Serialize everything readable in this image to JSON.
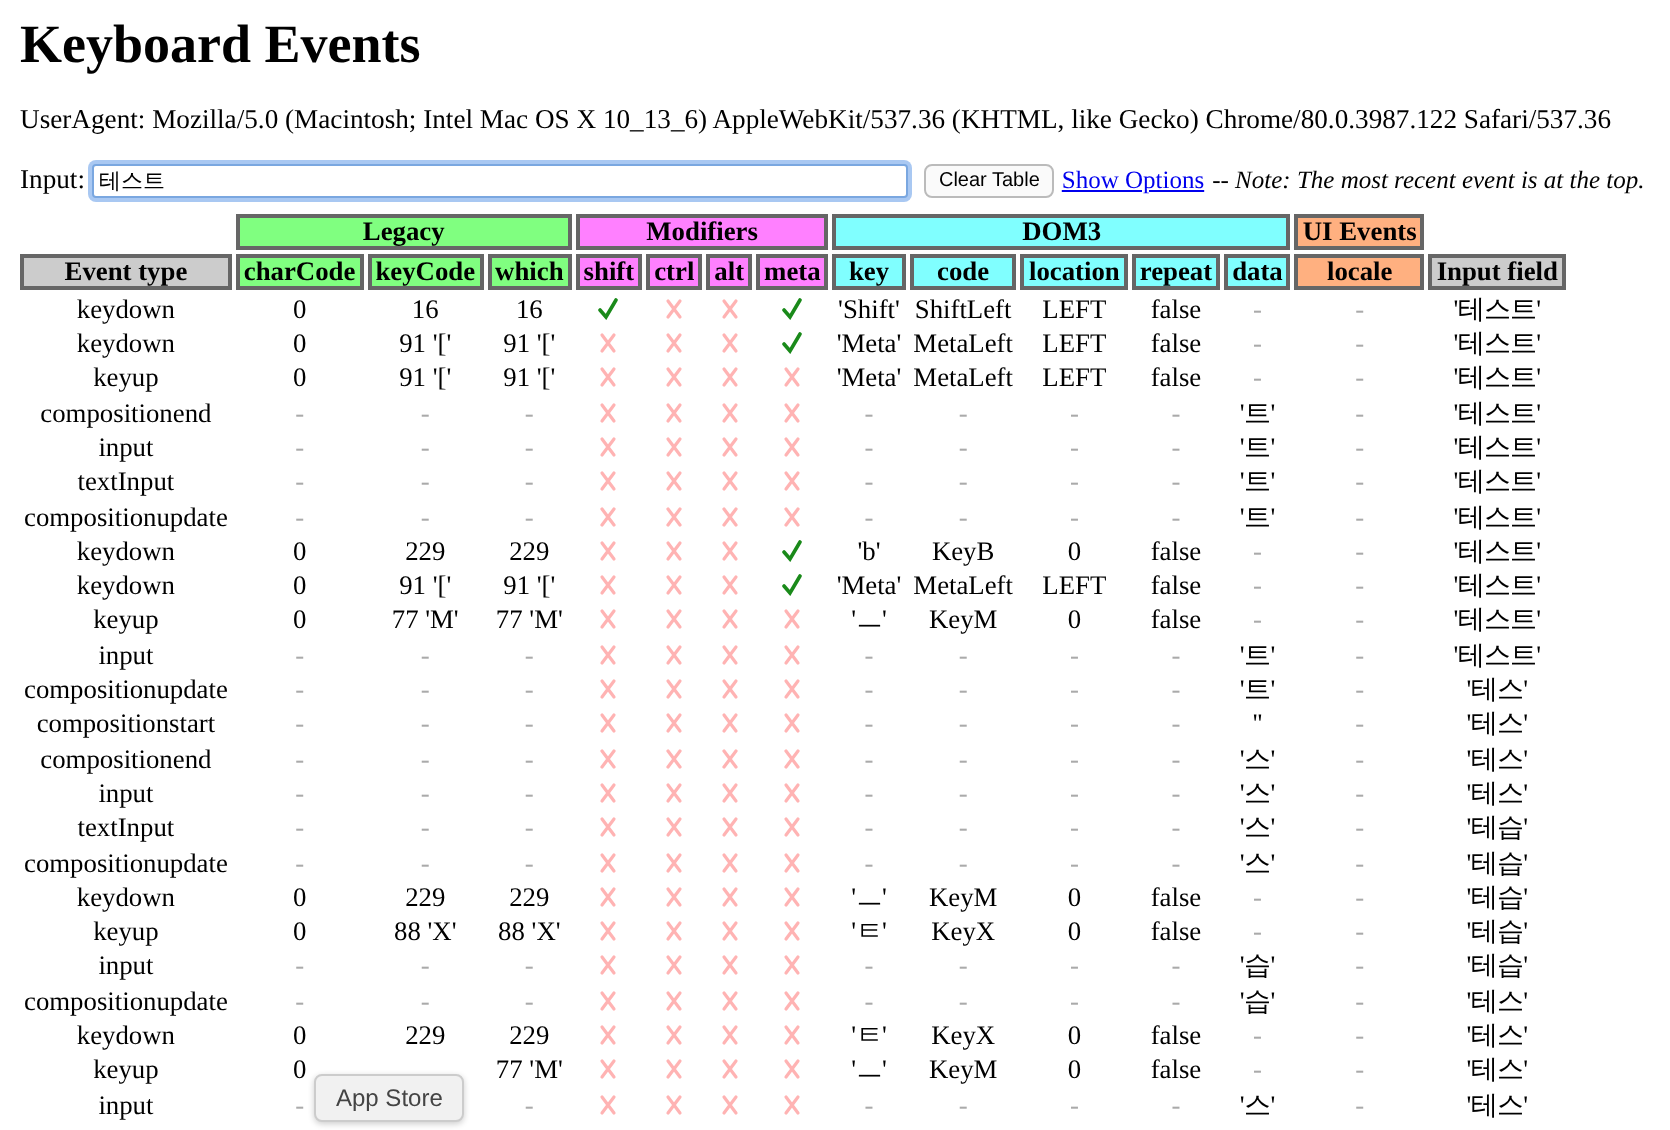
{
  "title": "Keyboard Events",
  "user_agent": "UserAgent: Mozilla/5.0 (Macintosh; Intel Mac OS X 10_13_6) AppleWebKit/537.36 (KHTML, like Gecko) Chrome/80.0.3987.122 Safari/537.36",
  "input": {
    "label": "Input:",
    "value": "테스트"
  },
  "clear_button": "Clear Table",
  "options_link": "Show Options",
  "note": "-- Note: The most recent event is at the top.",
  "table": {
    "first_column": "Event type",
    "last_column": "Input field",
    "groups": [
      {
        "label": "Legacy",
        "color": "#80ff80",
        "kind": "text",
        "columns": [
          "charCode",
          "keyCode",
          "which"
        ]
      },
      {
        "label": "Modifiers",
        "color": "#ff80ff",
        "kind": "flags",
        "columns": [
          "shift",
          "ctrl",
          "alt",
          "meta"
        ]
      },
      {
        "label": "DOM3",
        "color": "#80ffff",
        "kind": "text",
        "columns": [
          "key",
          "code",
          "location",
          "repeat",
          "data"
        ]
      },
      {
        "label": "UI Events",
        "color": "#ffb080",
        "kind": "text",
        "columns": [
          "locale"
        ]
      }
    ],
    "rows": [
      {
        "type": "keydown",
        "groups": [
          [
            "0",
            "16",
            "16"
          ],
          [
            true,
            false,
            false,
            true
          ],
          [
            "'Shift'",
            "ShiftLeft",
            "LEFT",
            "false",
            "-"
          ],
          [
            "-"
          ]
        ],
        "input": "'테스트'"
      },
      {
        "type": "keydown",
        "groups": [
          [
            "0",
            "91 '['",
            "91 '['"
          ],
          [
            false,
            false,
            false,
            true
          ],
          [
            "'Meta'",
            "MetaLeft",
            "LEFT",
            "false",
            "-"
          ],
          [
            "-"
          ]
        ],
        "input": "'테스트'"
      },
      {
        "type": "keyup",
        "groups": [
          [
            "0",
            "91 '['",
            "91 '['"
          ],
          [
            false,
            false,
            false,
            false
          ],
          [
            "'Meta'",
            "MetaLeft",
            "LEFT",
            "false",
            "-"
          ],
          [
            "-"
          ]
        ],
        "input": "'테스트'"
      },
      {
        "type": "compositionend",
        "groups": [
          [
            "-",
            "-",
            "-"
          ],
          [
            false,
            false,
            false,
            false
          ],
          [
            "-",
            "-",
            "-",
            "-",
            "'트'"
          ],
          [
            "-"
          ]
        ],
        "input": "'테스트'"
      },
      {
        "type": "input",
        "groups": [
          [
            "-",
            "-",
            "-"
          ],
          [
            false,
            false,
            false,
            false
          ],
          [
            "-",
            "-",
            "-",
            "-",
            "'트'"
          ],
          [
            "-"
          ]
        ],
        "input": "'테스트'"
      },
      {
        "type": "textInput",
        "groups": [
          [
            "-",
            "-",
            "-"
          ],
          [
            false,
            false,
            false,
            false
          ],
          [
            "-",
            "-",
            "-",
            "-",
            "'트'"
          ],
          [
            "-"
          ]
        ],
        "input": "'테스트'"
      },
      {
        "type": "compositionupdate",
        "groups": [
          [
            "-",
            "-",
            "-"
          ],
          [
            false,
            false,
            false,
            false
          ],
          [
            "-",
            "-",
            "-",
            "-",
            "'트'"
          ],
          [
            "-"
          ]
        ],
        "input": "'테스트'"
      },
      {
        "type": "keydown",
        "groups": [
          [
            "0",
            "229",
            "229"
          ],
          [
            false,
            false,
            false,
            true
          ],
          [
            "'b'",
            "KeyB",
            "0",
            "false",
            "-"
          ],
          [
            "-"
          ]
        ],
        "input": "'테스트'"
      },
      {
        "type": "keydown",
        "groups": [
          [
            "0",
            "91 '['",
            "91 '['"
          ],
          [
            false,
            false,
            false,
            true
          ],
          [
            "'Meta'",
            "MetaLeft",
            "LEFT",
            "false",
            "-"
          ],
          [
            "-"
          ]
        ],
        "input": "'테스트'"
      },
      {
        "type": "keyup",
        "groups": [
          [
            "0",
            "77 'M'",
            "77 'M'"
          ],
          [
            false,
            false,
            false,
            false
          ],
          [
            "'ㅡ'",
            "KeyM",
            "0",
            "false",
            "-"
          ],
          [
            "-"
          ]
        ],
        "input": "'테스트'"
      },
      {
        "type": "input",
        "groups": [
          [
            "-",
            "-",
            "-"
          ],
          [
            false,
            false,
            false,
            false
          ],
          [
            "-",
            "-",
            "-",
            "-",
            "'트'"
          ],
          [
            "-"
          ]
        ],
        "input": "'테스트'"
      },
      {
        "type": "compositionupdate",
        "groups": [
          [
            "-",
            "-",
            "-"
          ],
          [
            false,
            false,
            false,
            false
          ],
          [
            "-",
            "-",
            "-",
            "-",
            "'트'"
          ],
          [
            "-"
          ]
        ],
        "input": "'테스'"
      },
      {
        "type": "compositionstart",
        "groups": [
          [
            "-",
            "-",
            "-"
          ],
          [
            false,
            false,
            false,
            false
          ],
          [
            "-",
            "-",
            "-",
            "-",
            "''"
          ],
          [
            "-"
          ]
        ],
        "input": "'테스'"
      },
      {
        "type": "compositionend",
        "groups": [
          [
            "-",
            "-",
            "-"
          ],
          [
            false,
            false,
            false,
            false
          ],
          [
            "-",
            "-",
            "-",
            "-",
            "'스'"
          ],
          [
            "-"
          ]
        ],
        "input": "'테스'"
      },
      {
        "type": "input",
        "groups": [
          [
            "-",
            "-",
            "-"
          ],
          [
            false,
            false,
            false,
            false
          ],
          [
            "-",
            "-",
            "-",
            "-",
            "'스'"
          ],
          [
            "-"
          ]
        ],
        "input": "'테스'"
      },
      {
        "type": "textInput",
        "groups": [
          [
            "-",
            "-",
            "-"
          ],
          [
            false,
            false,
            false,
            false
          ],
          [
            "-",
            "-",
            "-",
            "-",
            "'스'"
          ],
          [
            "-"
          ]
        ],
        "input": "'테습'"
      },
      {
        "type": "compositionupdate",
        "groups": [
          [
            "-",
            "-",
            "-"
          ],
          [
            false,
            false,
            false,
            false
          ],
          [
            "-",
            "-",
            "-",
            "-",
            "'스'"
          ],
          [
            "-"
          ]
        ],
        "input": "'테습'"
      },
      {
        "type": "keydown",
        "groups": [
          [
            "0",
            "229",
            "229"
          ],
          [
            false,
            false,
            false,
            false
          ],
          [
            "'ㅡ'",
            "KeyM",
            "0",
            "false",
            "-"
          ],
          [
            "-"
          ]
        ],
        "input": "'테습'"
      },
      {
        "type": "keyup",
        "groups": [
          [
            "0",
            "88 'X'",
            "88 'X'"
          ],
          [
            false,
            false,
            false,
            false
          ],
          [
            "'ㅌ'",
            "KeyX",
            "0",
            "false",
            "-"
          ],
          [
            "-"
          ]
        ],
        "input": "'테습'"
      },
      {
        "type": "input",
        "groups": [
          [
            "-",
            "-",
            "-"
          ],
          [
            false,
            false,
            false,
            false
          ],
          [
            "-",
            "-",
            "-",
            "-",
            "'습'"
          ],
          [
            "-"
          ]
        ],
        "input": "'테습'"
      },
      {
        "type": "compositionupdate",
        "groups": [
          [
            "-",
            "-",
            "-"
          ],
          [
            false,
            false,
            false,
            false
          ],
          [
            "-",
            "-",
            "-",
            "-",
            "'습'"
          ],
          [
            "-"
          ]
        ],
        "input": "'테스'"
      },
      {
        "type": "keydown",
        "groups": [
          [
            "0",
            "229",
            "229"
          ],
          [
            false,
            false,
            false,
            false
          ],
          [
            "'ㅌ'",
            "KeyX",
            "0",
            "false",
            "-"
          ],
          [
            "-"
          ]
        ],
        "input": "'테스'"
      },
      {
        "type": "keyup",
        "groups": [
          {
            "charCode": "0",
            "which": "77 'M'"
          },
          [
            false,
            false,
            false,
            false
          ],
          [
            "'ㅡ'",
            "KeyM",
            "0",
            "false",
            "-"
          ],
          [
            "-"
          ]
        ],
        "input": "'테스'"
      },
      {
        "type": "input",
        "groups": [
          {
            "charCode": "-",
            "which": "-"
          },
          [
            false,
            false,
            false,
            false
          ],
          [
            "-",
            "-",
            "-",
            "-",
            "'스'"
          ],
          [
            "-"
          ]
        ],
        "input": "'테스'"
      }
    ]
  },
  "tooltip": "App Store"
}
